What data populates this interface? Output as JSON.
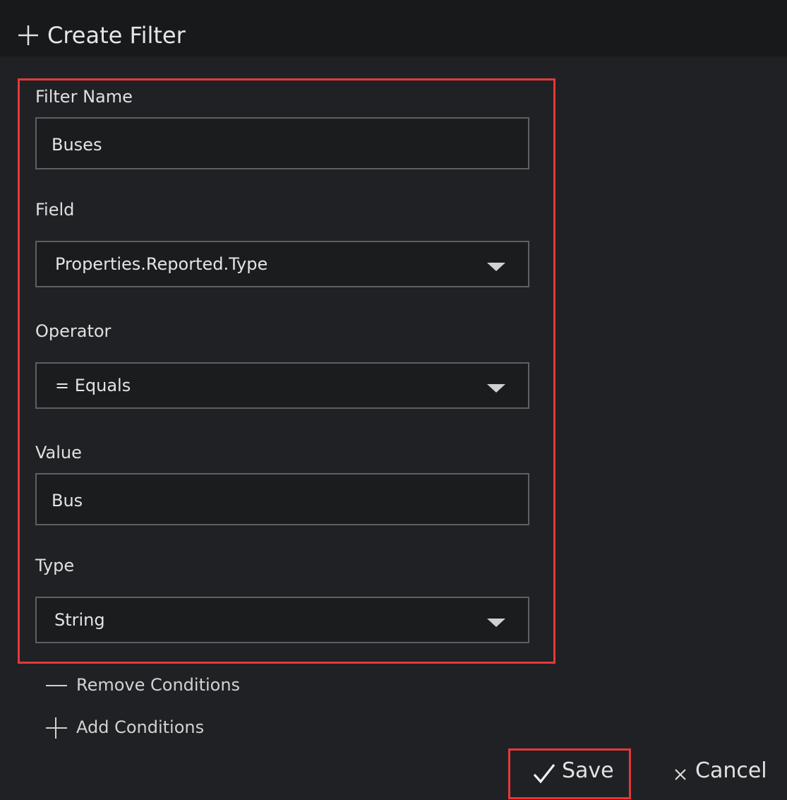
{
  "header": {
    "title": "Create Filter",
    "icon": "plus-icon"
  },
  "form": {
    "filter_name": {
      "label": "Filter Name",
      "value": "Buses"
    },
    "field": {
      "label": "Field",
      "value": "Properties.Reported.Type"
    },
    "operator": {
      "label": "Operator",
      "value": "= Equals"
    },
    "value": {
      "label": "Value",
      "value": "Bus"
    },
    "type": {
      "label": "Type",
      "value": "String"
    }
  },
  "conditions": {
    "remove_label": "Remove Conditions",
    "add_label": "Add Conditions"
  },
  "actions": {
    "save_label": "Save",
    "cancel_label": "Cancel"
  },
  "colors": {
    "background": "#202124",
    "header": "#18191b",
    "highlight": "#e5383b",
    "border": "#5d5f63"
  }
}
